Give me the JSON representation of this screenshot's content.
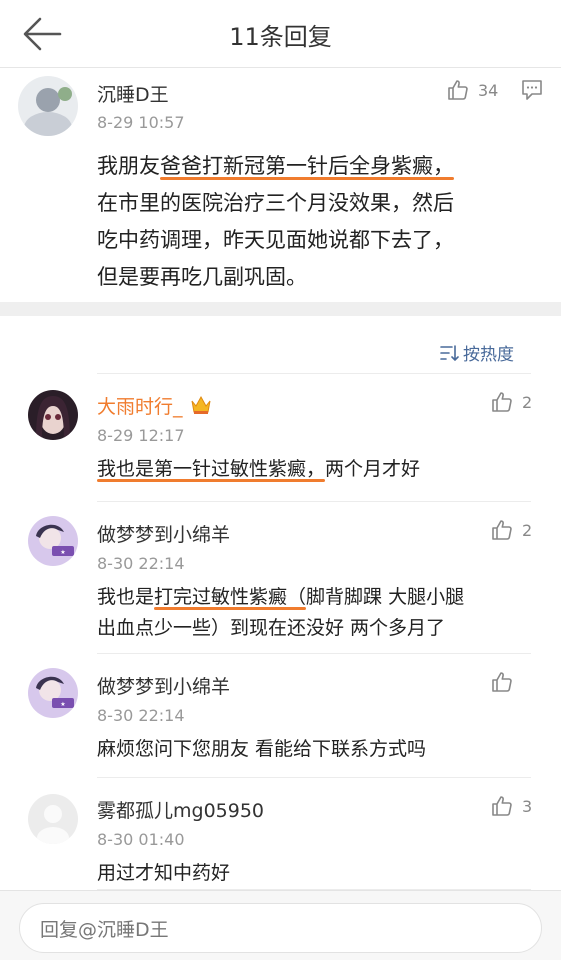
{
  "header": {
    "title": "11条回复"
  },
  "main_post": {
    "username": "沉睡D王",
    "time": "8-29 10:57",
    "likes": "34",
    "lines": [
      [
        {
          "t": "我朋友",
          "u": false
        },
        {
          "t": "爸爸打新冠第一针后全身紫癜，",
          "u": true
        }
      ],
      [
        {
          "t": "在市里的医院治疗三个月没效果，然后",
          "u": false
        }
      ],
      [
        {
          "t": "吃中药调理，昨天见面她说都下去了，",
          "u": false
        }
      ],
      [
        {
          "t": "但是要再吃几副巩固。",
          "u": false
        }
      ]
    ]
  },
  "sort": {
    "label": "按热度"
  },
  "replies": [
    {
      "username": "大雨时行_",
      "vip": true,
      "time": "8-29 12:17",
      "likes": "2",
      "lines": [
        [
          {
            "t": "我也是第一针过敏性紫癜，",
            "u": true
          },
          {
            "t": "两个月才好",
            "u": false
          }
        ]
      ]
    },
    {
      "username": "做梦梦到小绵羊",
      "vip": false,
      "time": "8-30 22:14",
      "likes": "2",
      "lines": [
        [
          {
            "t": "我也是",
            "u": false
          },
          {
            "t": "打完过敏性紫癜（",
            "u": true
          },
          {
            "t": "脚背脚踝  大腿小腿",
            "u": false
          }
        ],
        [
          {
            "t": "出血点少一些）到现在还没好  两个多月了",
            "u": false
          }
        ]
      ]
    },
    {
      "username": "做梦梦到小绵羊",
      "vip": false,
      "time": "8-30 22:14",
      "likes": "",
      "lines": [
        [
          {
            "t": "麻烦您问下您朋友  看能给下联系方式吗",
            "u": false
          }
        ]
      ]
    },
    {
      "username": "雾都孤儿mg05950",
      "vip": false,
      "time": "8-30 01:40",
      "likes": "3",
      "lines": [
        [
          {
            "t": "用过才知中药好",
            "u": false
          }
        ]
      ]
    }
  ],
  "reply_box": {
    "placeholder": "回复@沉睡D王"
  },
  "colors": {
    "accent_orange": "#f07c2e",
    "link_blue": "#496a9a",
    "vip_name": "#f07c2e"
  }
}
